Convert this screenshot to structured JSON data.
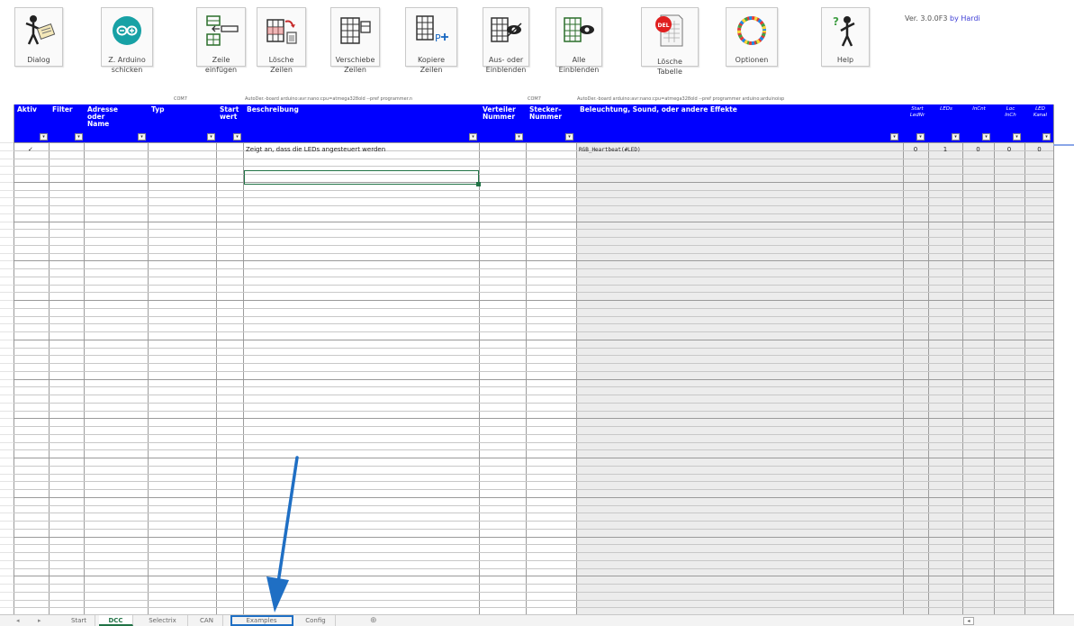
{
  "ribbon": {
    "buttons": [
      {
        "label": "Dialog",
        "icon": "dialog-figure-icon"
      },
      {
        "label": "Z. Arduino\nschicken",
        "icon": "arduino-logo-icon"
      },
      {
        "label": "Zeile\neinfügen",
        "icon": "insert-row-icon"
      },
      {
        "label": "Lösche\nZeilen",
        "icon": "delete-rows-icon"
      },
      {
        "label": "Verschiebe\nZeilen",
        "icon": "move-rows-icon"
      },
      {
        "label": "Kopiere\nZeilen",
        "icon": "copy-rows-icon"
      },
      {
        "label": "Aus- oder\nEinblenden",
        "icon": "toggle-visibility-icon"
      },
      {
        "label": "Alle\nEinblenden",
        "icon": "show-all-icon"
      },
      {
        "label": "Lösche\nTabelle",
        "icon": "delete-table-icon"
      },
      {
        "label": "Optionen",
        "icon": "options-ring-icon"
      },
      {
        "label": "Help",
        "icon": "help-figure-icon"
      }
    ],
    "version": "Ver. 3.0.0F3",
    "version_by": "by Hardi"
  },
  "sheet": {
    "top_labels": [
      "COM7",
      "AutoDer.-board arduino:avr:nano:cpu=atmega328old --pref programmer.n",
      "COM7",
      "AutoDer.-board arduino:avr:nano:cpu=atmega328old --pref programmer arduino:arduinoisp"
    ],
    "headers": {
      "aktiv": "Aktiv",
      "filter": "Filter",
      "adresse": "Adresse\noder Name",
      "typ": "Typ",
      "start": "Start\nwert",
      "beschreibung": "Beschreibung",
      "verteiler": "Verteiler\nNummer",
      "stecker": "Stecker-\nNummer",
      "effekte": "Beleuchtung, Sound, oder andere Effekte",
      "start_ledn": "Start\nLedNr",
      "leds": "LEDs",
      "incnt": "InCnt",
      "loc_incn": "Loc\nInCh",
      "led_kanal": "LED\nKanal"
    },
    "row1": {
      "aktiv": "✓",
      "beschreibung": "Zeigt an, dass die LEDs angesteuert werden",
      "effekte": "RGB_Heartbeat(#LED)",
      "start_ledn": "0",
      "leds": "1",
      "incnt": "0",
      "loc_incn": "0",
      "led_kanal": "0"
    }
  },
  "tabs": {
    "nav_prev": "◂",
    "nav_next": "▸",
    "items": [
      "Start",
      "DCC",
      "Selectrix",
      "CAN",
      "Examples",
      "Config"
    ],
    "add": "⊕",
    "scroll": "◂"
  },
  "colors": {
    "header_blue": "#0000ff",
    "active_tab": "#217346",
    "annotation_arrow": "#1f6fc4"
  }
}
